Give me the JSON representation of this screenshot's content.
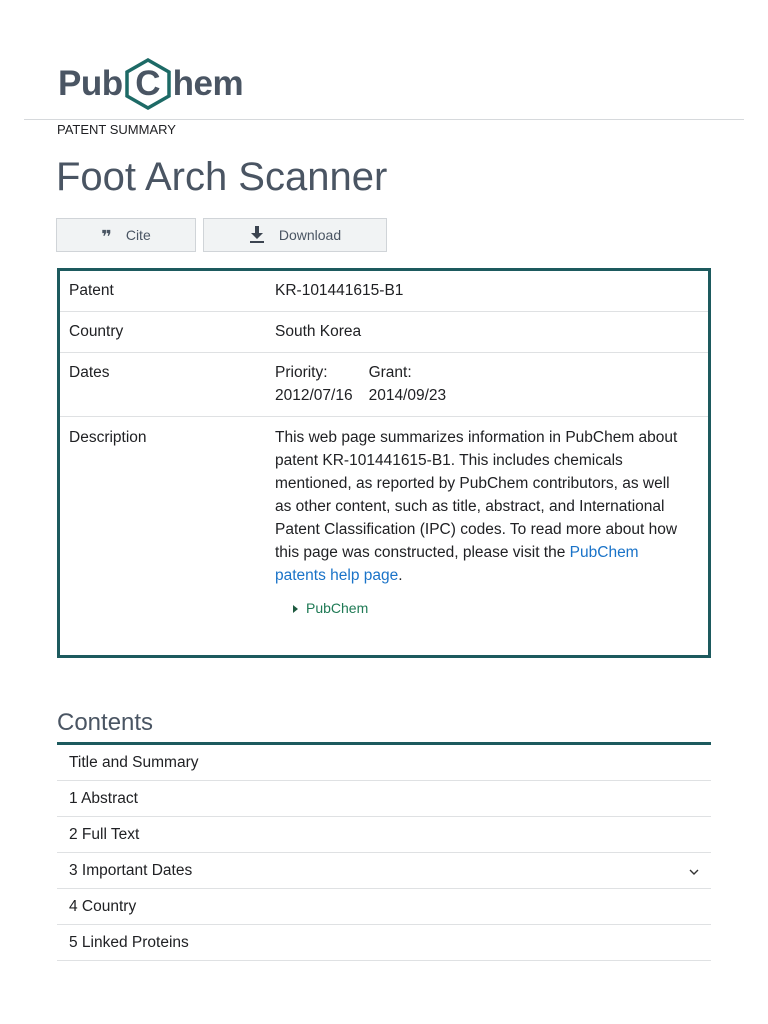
{
  "logo": {
    "part1": "Pub",
    "part2": "C",
    "part3": "hem"
  },
  "kicker": "PATENT SUMMARY",
  "title": "Foot Arch Scanner",
  "buttons": {
    "cite": "Cite",
    "download": "Download"
  },
  "summary": {
    "patent_label": "Patent",
    "patent_value": "KR-101441615-B1",
    "country_label": "Country",
    "country_value": "South Korea",
    "dates_label": "Dates",
    "priority_label": "Priority:",
    "priority_value": "2012/07/16",
    "grant_label": "Grant:",
    "grant_value": "2014/09/23",
    "description_label": "Description",
    "description_text": "This web page summarizes information in PubChem about patent KR-101441615-B1. This includes chemicals mentioned, as reported by PubChem contributors, as well as other content, such as title, abstract, and International Patent Classification (IPC) codes. To read more about how this page was constructed, please visit the ",
    "description_link": "PubChem patents help page",
    "description_end": ".",
    "source": "PubChem"
  },
  "contents": {
    "heading": "Contents",
    "items": [
      "Title and Summary",
      "1 Abstract",
      "2 Full Text",
      "3 Important Dates",
      "4 Country",
      "5 Linked Proteins"
    ]
  },
  "colors": {
    "accent": "#1d5a5e",
    "link": "#1a73c8",
    "source": "#1f7a55"
  }
}
